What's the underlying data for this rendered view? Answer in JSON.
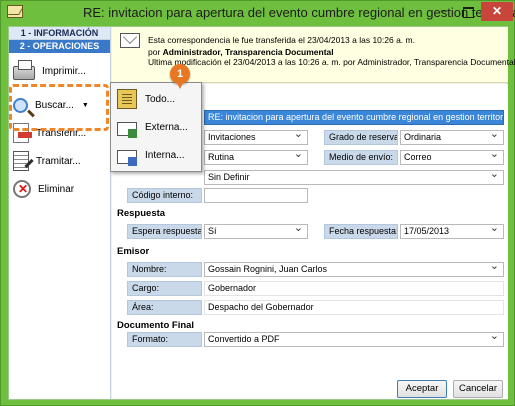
{
  "window": {
    "title": "RE: invitacion para apertura del evento cumbre regional en gestion territorial",
    "minimize": "–",
    "close": "✕"
  },
  "sidebar": {
    "tabs": [
      "1 - INFORMACIÓN",
      "2 - OPERACIONES"
    ],
    "actions": [
      {
        "label": "Imprimir...",
        "icon": "printer-icon"
      },
      {
        "label": "Buscar...",
        "icon": "search-icon",
        "caret": "▼"
      },
      {
        "label": "Transferir...",
        "icon": "transfer-icon"
      },
      {
        "label": "Tramitar...",
        "icon": "process-icon"
      },
      {
        "label": "Eliminar",
        "icon": "delete-icon"
      }
    ]
  },
  "notice": {
    "line1": "Esta correspondencia le fue transferida el 23/04/2013 a las 10:26 a. m.",
    "line2_prefix": "por ",
    "line2_bold": "Administrador, Transparencia Documental",
    "line3": "Ultima modificación el 23/04/2013 a las 10:26 a. m. por Administrador, Transparencia Documental."
  },
  "form": {
    "subject_value": "RE: invitacion para apertura del evento cumbre regional en gestion territorial",
    "type_value": "Invitaciones",
    "reserve_label": "Grado de reserva:",
    "reserve_value": "Ordinaria",
    "route_value": "Rutina",
    "send_label": "Medio de envío:",
    "send_value": "Correo",
    "dest_value": "Sin Definir",
    "internal_code_label": "Código interno:",
    "internal_code_value": "",
    "response_section": "Respuesta",
    "wait_label": "Espera respuesta:",
    "wait_value": "Sí",
    "date_label": "Fecha respuesta:",
    "date_value": "17/05/2013",
    "sender_section": "Emisor",
    "name_label": "Nombre:",
    "name_value": "Gossain Rognini, Juan Carlos",
    "role_label": "Cargo:",
    "role_value": "Gobernador",
    "area_label": "Área:",
    "area_value": "Despacho del Gobernador",
    "final_section": "Documento Final",
    "format_label": "Formato:",
    "format_value": "Convertido a PDF"
  },
  "buttons": {
    "accept": "Aceptar",
    "cancel": "Cancelar"
  },
  "popup": {
    "items": [
      "Todo...",
      "Externa...",
      "Interna..."
    ]
  },
  "callout": {
    "number": "1",
    "color": "#e87722"
  }
}
